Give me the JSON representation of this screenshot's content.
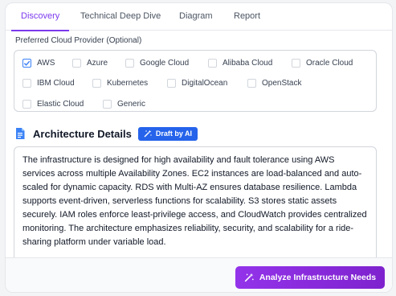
{
  "tabs": [
    {
      "label": "Discovery",
      "active": true
    },
    {
      "label": "Technical Deep Dive",
      "active": false
    },
    {
      "label": "Diagram",
      "active": false
    },
    {
      "label": "Report",
      "active": false
    }
  ],
  "cloud_provider": {
    "label": "Preferred Cloud Provider (Optional)",
    "options": [
      {
        "label": "AWS",
        "checked": true
      },
      {
        "label": "Azure",
        "checked": false
      },
      {
        "label": "Google Cloud",
        "checked": false
      },
      {
        "label": "Alibaba Cloud",
        "checked": false
      },
      {
        "label": "Oracle Cloud",
        "checked": false
      },
      {
        "label": "IBM Cloud",
        "checked": false
      },
      {
        "label": "Kubernetes",
        "checked": false
      },
      {
        "label": "DigitalOcean",
        "checked": false
      },
      {
        "label": "OpenStack",
        "checked": false
      },
      {
        "label": "Elastic Cloud",
        "checked": false
      },
      {
        "label": "Generic",
        "checked": false
      }
    ]
  },
  "architecture": {
    "title": "Architecture Details",
    "badge": "Draft by AI",
    "text": "The infrastructure is designed for high availability and fault tolerance using AWS services across multiple Availability Zones. EC2 instances are load-balanced and auto-scaled for dynamic capacity. RDS with Multi-AZ ensures database resilience. Lambda supports event-driven, serverless functions for scalability. S3 stores static assets securely. IAM roles enforce least-privilege access, and CloudWatch provides centralized monitoring. The architecture emphasizes reliability, security, and scalability for a ride-sharing platform under variable load."
  },
  "footer": {
    "analyze_label": "Analyze Infrastructure Needs"
  },
  "icons": {
    "document": "document-icon",
    "magic_wand": "magic-wand-icon",
    "check": "check-icon"
  },
  "colors": {
    "accent": "#7c3aed",
    "badge": "#2563eb",
    "button": "#9333ea",
    "checkbox_checked": "#3b82f6"
  }
}
